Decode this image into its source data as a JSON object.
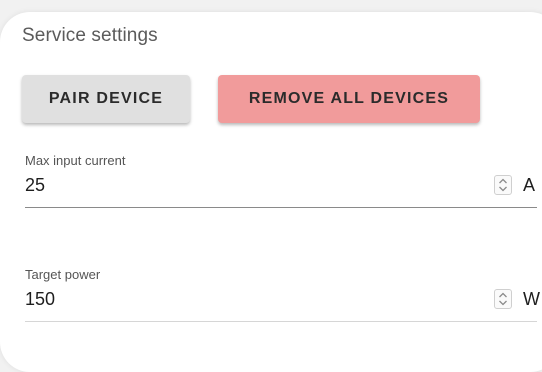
{
  "panel": {
    "title": "Service settings"
  },
  "buttons": {
    "pair_label": "PAIR DEVICE",
    "remove_label": "REMOVE ALL DEVICES",
    "remove_color": "#f19b9b",
    "pair_color": "#e0e0e0"
  },
  "fields": {
    "max_input_current": {
      "label": "Max input current",
      "value": "25",
      "unit": "A"
    },
    "target_power": {
      "label": "Target power",
      "value": "150",
      "unit": "W"
    }
  },
  "icons": {
    "stepper": "up-down-chevron-icon"
  }
}
